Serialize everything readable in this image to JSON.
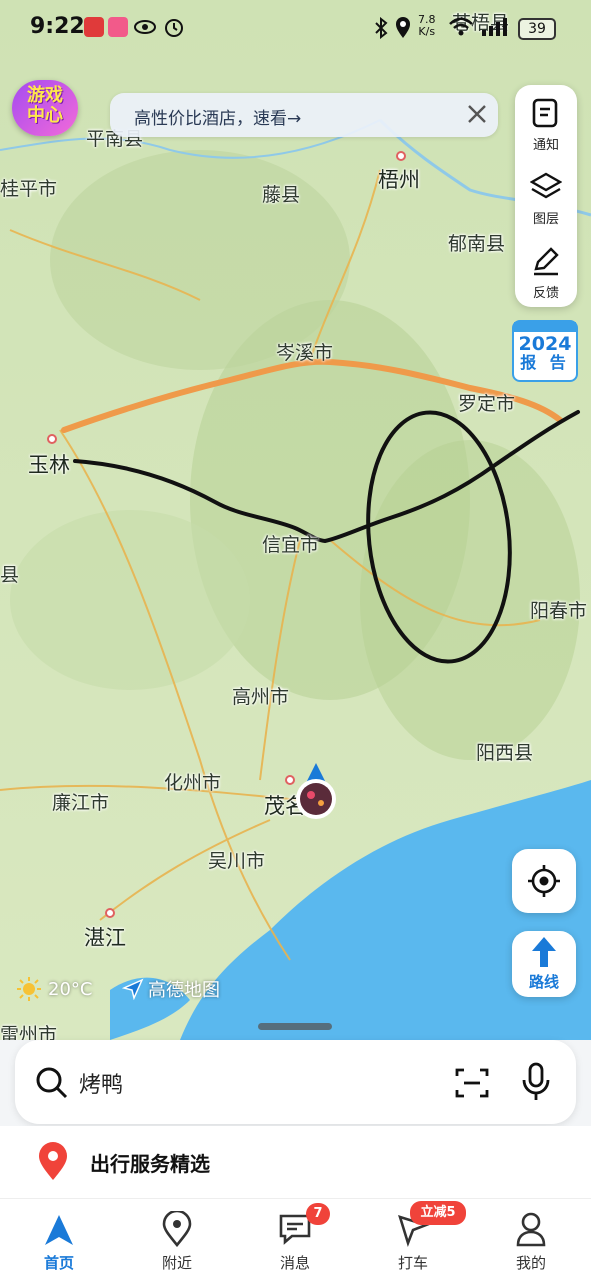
{
  "status_bar": {
    "time": "9:22",
    "net_speed_top": "7.8",
    "net_speed_unit": "K/s",
    "battery": "39"
  },
  "game_center": {
    "line1": "游戏",
    "line2": "中心"
  },
  "promo": {
    "text": "高性价比酒店，速看→"
  },
  "tools": {
    "notify": "通知",
    "layers": "图层",
    "feedback": "反馈"
  },
  "report": {
    "year": "2024",
    "label": "报 告"
  },
  "places": {
    "cangwu": "苍梧县",
    "pingnan": "平南县",
    "guiping": "桂平市",
    "tengxian": "藤县",
    "wuzhou": "梧州",
    "yunan": "郁南县",
    "cenxi": "岑溪市",
    "luoding": "罗定市",
    "yulin": "玉林",
    "xinyi": "信宜市",
    "county_left": "县",
    "yangchun": "阳春市",
    "gaozhou": "高州市",
    "yangxi": "阳西县",
    "huazhou": "化州市",
    "lianjiang": "廉江市",
    "maoming": "茂名",
    "wuchuan": "吴川市",
    "zhanjiang": "湛江",
    "leizhou": "雷州市"
  },
  "weather": {
    "temp": "20°C"
  },
  "brand": {
    "name": "高德地图"
  },
  "search": {
    "query": "烤鸭"
  },
  "services": {
    "title": "出行服务精选"
  },
  "tabs": [
    {
      "label": "首页"
    },
    {
      "label": "附近"
    },
    {
      "label": "消息",
      "badge": "7"
    },
    {
      "label": "打车",
      "badge": "立减5"
    },
    {
      "label": "我的"
    }
  ],
  "colors": {
    "accent": "#1a7ad8",
    "badge": "#f0433a",
    "orange_line": "#ef9a4a",
    "sea": "#5ab8ee"
  }
}
